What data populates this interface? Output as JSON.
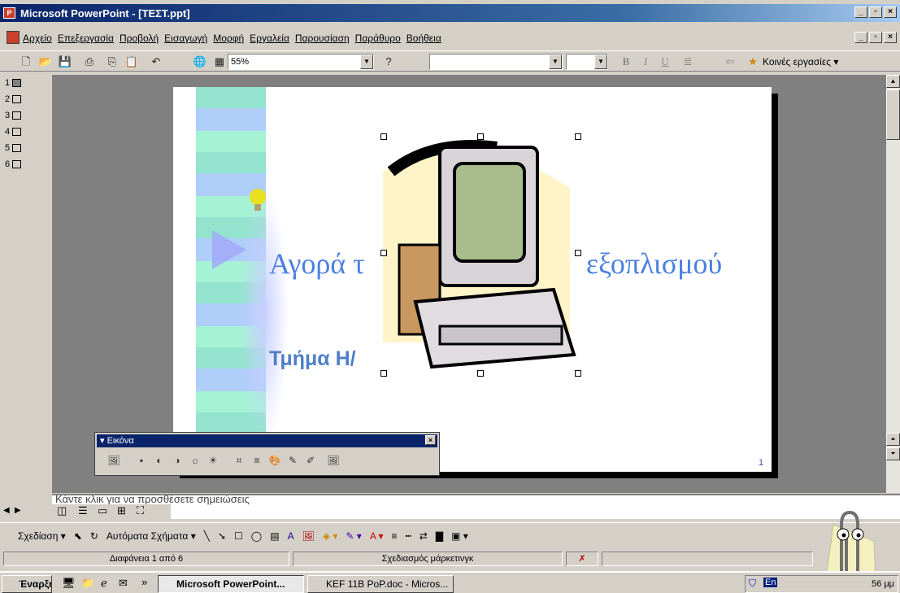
{
  "window": {
    "title": "Microsoft PowerPoint - [ΤΕΣΤ.ppt]",
    "min": "_",
    "restore": "&#x25A1;",
    "close": "×"
  },
  "menu": [
    "Αρχείο",
    "Επεξεργασία",
    "Προβολή",
    "Εισαγωγή",
    "Μορφή",
    "Εργαλεία",
    "Παρουσίαση",
    "Παράθυρο",
    "Βοήθεια"
  ],
  "toolbar": {
    "zoom": "55%",
    "common_tasks": "Κοινές εργασίες",
    "bold": "B",
    "italic": "I",
    "underline": "U"
  },
  "outline": {
    "slides": [
      "1",
      "2",
      "3",
      "4",
      "5",
      "6"
    ]
  },
  "slide": {
    "title_left": "Αγορά τ",
    "title_right": "εξοπλισμού",
    "subtitle": "Τμήμα Η/",
    "number": "1"
  },
  "picture_toolbar": {
    "title": "Εικόνα",
    "close": "×"
  },
  "notes": {
    "placeholder": "Κάντε κλικ για να προσθέσετε σημειώσεις"
  },
  "drawing_toolbar": {
    "draw": "Σχεδίαση",
    "autoshapes": "Αυτόματα Σχήματα"
  },
  "status": {
    "slide": "Διαφάνεια 1 από 6",
    "design": "Σχεδιασμός μάρκετινγκ"
  },
  "taskbar": {
    "start": "Έναρξη",
    "app1": "Microsoft PowerPoint...",
    "app2": "KEF 11B PoP.doc - Micros...",
    "lang": "En",
    "time": "56 μμ"
  }
}
